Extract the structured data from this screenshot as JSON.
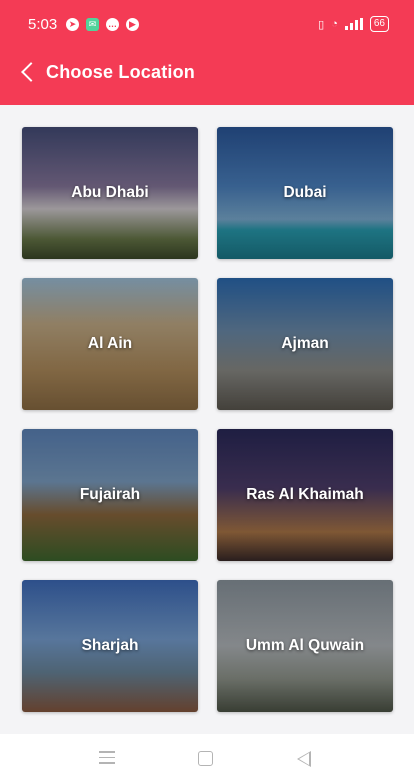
{
  "status": {
    "time": "5:03",
    "battery": "66"
  },
  "appbar": {
    "title": "Choose Location"
  },
  "locations": [
    {
      "name": "Abu Dhabi"
    },
    {
      "name": "Dubai"
    },
    {
      "name": "Al Ain"
    },
    {
      "name": "Ajman"
    },
    {
      "name": "Fujairah"
    },
    {
      "name": "Ras Al Khaimah"
    },
    {
      "name": "Sharjah"
    },
    {
      "name": "Umm Al Quwain"
    }
  ],
  "colors": {
    "primary": "#f43b55",
    "background": "#f4f4f6"
  },
  "icons": {
    "back": "chevron-left-icon",
    "nav_menu": "menu-icon",
    "nav_home": "square-icon",
    "nav_back": "triangle-left-icon"
  }
}
